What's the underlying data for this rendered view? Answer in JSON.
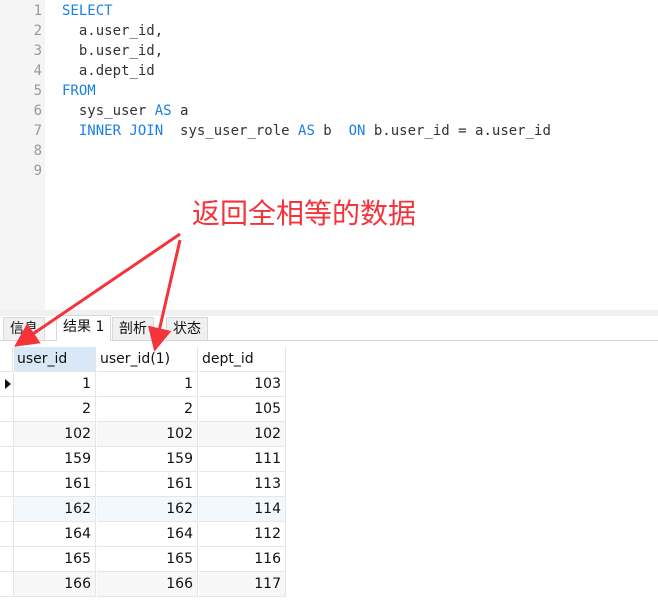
{
  "editor": {
    "line_numbers": [
      "1",
      "2",
      "3",
      "4",
      "5",
      "6",
      "7",
      "8",
      "9"
    ],
    "lines": [
      [
        {
          "t": "SELECT",
          "kw": true
        }
      ],
      [
        {
          "t": "  a.user_id,"
        }
      ],
      [
        {
          "t": "  b.user_id,"
        }
      ],
      [
        {
          "t": "  a.dept_id"
        }
      ],
      [
        {
          "t": "FROM",
          "kw": true
        }
      ],
      [
        {
          "t": "  sys_user "
        },
        {
          "t": "AS",
          "kw": true
        },
        {
          "t": " a"
        }
      ],
      [
        {
          "t": "  "
        },
        {
          "t": "INNER JOIN",
          "kw": true
        },
        {
          "t": "  sys_user_role "
        },
        {
          "t": "AS",
          "kw": true
        },
        {
          "t": " b  "
        },
        {
          "t": "ON",
          "kw": true
        },
        {
          "t": " b.user_id = a.user_id"
        }
      ],
      [],
      []
    ]
  },
  "annotation": "返回全相等的数据",
  "tabs": [
    {
      "label": "信息"
    },
    {
      "label": "结果 1",
      "active": true
    },
    {
      "label": "剖析"
    },
    {
      "label": "状态"
    }
  ],
  "grid": {
    "columns": [
      "user_id",
      "user_id(1)",
      "dept_id"
    ],
    "rows": [
      [
        "1",
        "1",
        "103"
      ],
      [
        "2",
        "2",
        "105"
      ],
      [
        "102",
        "102",
        "102"
      ],
      [
        "159",
        "159",
        "111"
      ],
      [
        "161",
        "161",
        "113"
      ],
      [
        "162",
        "162",
        "114"
      ],
      [
        "164",
        "164",
        "112"
      ],
      [
        "165",
        "165",
        "116"
      ],
      [
        "166",
        "166",
        "117"
      ]
    ]
  }
}
